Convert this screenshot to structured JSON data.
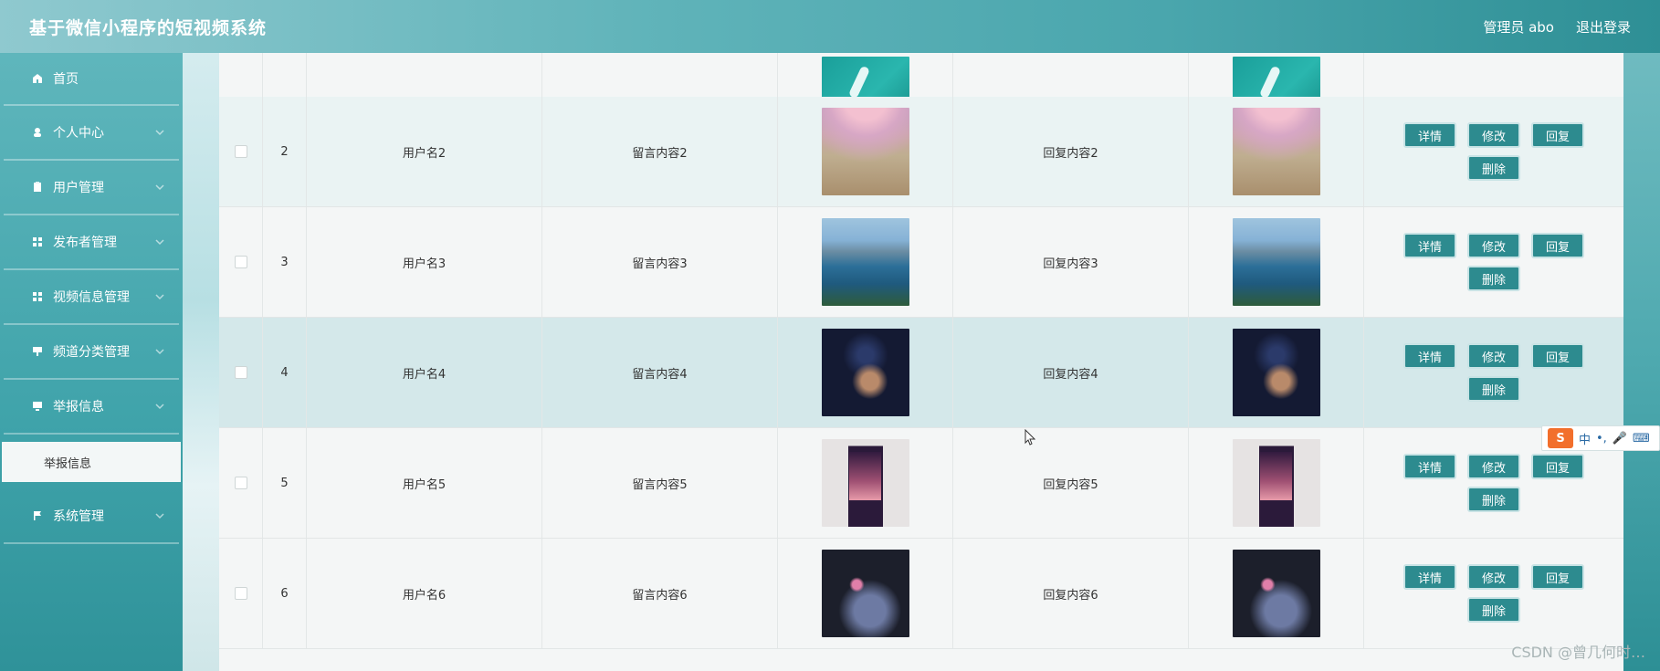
{
  "header": {
    "title": "基于微信小程序的短视频系统",
    "admin_label": "管理员 abo",
    "logout_label": "退出登录"
  },
  "sidebar": {
    "items": [
      {
        "label": "首页",
        "icon": "home-icon"
      },
      {
        "label": "个人中心",
        "icon": "user-icon"
      },
      {
        "label": "用户管理",
        "icon": "clipboard-icon"
      },
      {
        "label": "发布者管理",
        "icon": "grid-icon"
      },
      {
        "label": "视频信息管理",
        "icon": "grid-icon"
      },
      {
        "label": "频道分类管理",
        "icon": "sign-icon"
      },
      {
        "label": "举报信息",
        "icon": "monitor-icon"
      }
    ],
    "submenu_report": "举报信息",
    "system_label": "系统管理"
  },
  "table": {
    "rows": [
      {
        "index": "",
        "user": "",
        "message": "",
        "reply": "",
        "img": "img-teal",
        "img2": "img-teal"
      },
      {
        "index": "2",
        "user": "用户名2",
        "message": "留言内容2",
        "reply": "回复内容2",
        "img": "img-rainbow",
        "img2": "img-rainbow"
      },
      {
        "index": "3",
        "user": "用户名3",
        "message": "留言内容3",
        "reply": "回复内容3",
        "img": "img-lake",
        "img2": "img-lake"
      },
      {
        "index": "4",
        "user": "用户名4",
        "message": "留言内容4",
        "reply": "回复内容4",
        "img": "img-night",
        "img2": "img-night"
      },
      {
        "index": "5",
        "user": "用户名5",
        "message": "留言内容5",
        "reply": "回复内容5",
        "img": "img-pink",
        "img2": "img-pink"
      },
      {
        "index": "6",
        "user": "用户名6",
        "message": "留言内容6",
        "reply": "回复内容6",
        "img": "img-moon",
        "img2": "img-moon"
      }
    ],
    "buttons": {
      "detail": "详情",
      "edit": "修改",
      "reply": "回复",
      "delete": "删除"
    }
  },
  "overlay": {
    "ime_label": "中",
    "watermark": "CSDN @曾几何时…"
  }
}
